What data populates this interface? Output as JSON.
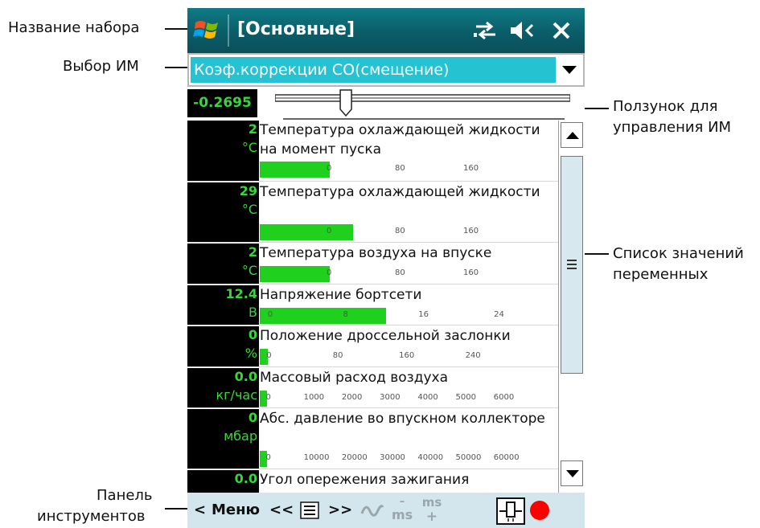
{
  "callouts": {
    "set_name": "Название набора",
    "im_select": "Выбор ИМ",
    "slider_line1": "Ползунок для",
    "slider_line2": "управления ИМ",
    "list_line1": "Список значений",
    "list_line2": "переменных",
    "toolbar_line1": "Панель",
    "toolbar_line2": "инструментов"
  },
  "titlebar": {
    "title": "[Основные]",
    "icons": [
      "windows-start-icon",
      "connection-icon",
      "speaker-muted-icon",
      "close-icon"
    ]
  },
  "im_selector": {
    "value": "Коэф.коррекции CO(смещение)"
  },
  "actuator": {
    "value": "-0.2695",
    "slider_position": 0.24
  },
  "colors": {
    "titlebar": "#0a5d69",
    "value_green": "#39d63a",
    "gauge_green": "#1fd01f",
    "selector_bg": "#25c2d1",
    "toolbar_bg": "#d3e6ee",
    "record_red": "#ff0000"
  },
  "parameters": [
    {
      "value": "2",
      "unit": "°C",
      "name": "Температура охлаждающей жидкости на момент пуска",
      "ticks": [
        "0",
        "80",
        "160"
      ],
      "range": [
        -80,
        240
      ],
      "reading": 2
    },
    {
      "value": "29",
      "unit": "°C",
      "name": "Температура охлаждающей жидкости",
      "ticks": [
        "0",
        "80",
        "160"
      ],
      "range": [
        -80,
        240
      ],
      "reading": 29
    },
    {
      "value": "2",
      "unit": "°C",
      "name": "Температура воздуха на впуске",
      "ticks": [
        "0",
        "80",
        "160"
      ],
      "range": [
        -80,
        240
      ],
      "reading": 2
    },
    {
      "value": "12.4",
      "unit": "В",
      "name": "Напряжение бортсети",
      "ticks": [
        "0",
        "8",
        "16",
        "24"
      ],
      "range": [
        -1,
        28
      ],
      "reading": 12.4
    },
    {
      "value": "0",
      "unit": "%",
      "name": "Положение дроссельной заслонки",
      "ticks": [
        "0",
        "80",
        "160",
        "240"
      ],
      "range": [
        -10,
        320
      ],
      "reading": 0
    },
    {
      "value": "0.0",
      "unit": "кг/час",
      "name": "Массовый расход воздуха",
      "ticks": [
        "0",
        "1000",
        "2000",
        "3000",
        "4000",
        "5000",
        "6000"
      ],
      "range": [
        -200,
        7000
      ],
      "reading": 0
    },
    {
      "value": "0",
      "unit": "мбар",
      "name": "Абс. давление во впускном коллекторе",
      "ticks": [
        "0",
        "10000",
        "20000",
        "30000",
        "40000",
        "50000",
        "60000"
      ],
      "range": [
        -2000,
        70000
      ],
      "reading": 0
    },
    {
      "value": "0.0",
      "unit": "",
      "name": "Угол опережения зажигания",
      "ticks": [],
      "range": [
        0,
        1
      ],
      "reading": 0
    }
  ],
  "toolbar": {
    "back": "<",
    "menu": "Меню",
    "prev": "<<",
    "next": ">>",
    "ms_minus_top": "–",
    "ms_minus_bottom": "ms",
    "ms_plus_top": "ms",
    "ms_plus_bottom": "+"
  }
}
